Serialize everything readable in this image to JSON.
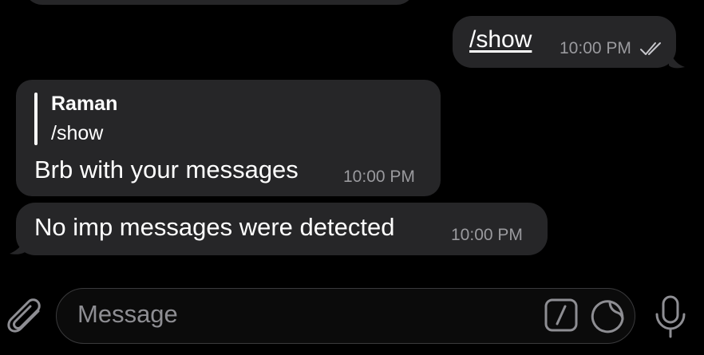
{
  "messages": {
    "outgoing": {
      "text": "/show",
      "time": "10:00 PM"
    },
    "incoming_reply": {
      "reply_to_name": "Raman",
      "reply_to_text": "/show",
      "text": "Brb with your messages",
      "time": "10:00 PM"
    },
    "incoming_2": {
      "text": "No imp messages were detected",
      "time": "10:00 PM"
    }
  },
  "composer": {
    "placeholder": "Message"
  },
  "icons": {
    "attach": "paperclip-icon",
    "command": "slash-command-icon",
    "sticker": "sticker-icon",
    "mic": "microphone-icon",
    "read_status": "double-check-icon"
  },
  "colors": {
    "background": "#000000",
    "bubble": "#262628",
    "timestamp": "#9a9a9e",
    "placeholder": "#8e8e93"
  }
}
